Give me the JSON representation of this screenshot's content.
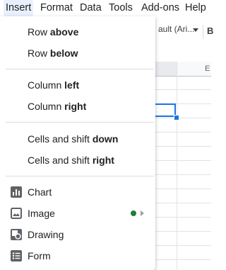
{
  "menubar": {
    "items": [
      "Insert",
      "Format",
      "Data",
      "Tools",
      "Add-ons",
      "Help"
    ]
  },
  "toolbar": {
    "left_glyph": "'",
    "font_name": "ault (Ari...",
    "bold_icon": "B"
  },
  "sheet": {
    "column_letter": "E"
  },
  "insert_menu": {
    "row_above": {
      "prefix": "Row ",
      "bold": "above"
    },
    "row_below": {
      "prefix": "Row ",
      "bold": "below"
    },
    "column_left": {
      "prefix": "Column ",
      "bold": "left"
    },
    "column_right": {
      "prefix": "Column ",
      "bold": "right"
    },
    "cells_down": {
      "prefix": "Cells and shift ",
      "bold": "down"
    },
    "cells_right": {
      "prefix": "Cells and shift ",
      "bold": "right"
    },
    "chart": "Chart",
    "image": "Image",
    "drawing": "Drawing",
    "form": "Form"
  },
  "colors": {
    "accent": "#1a73e8",
    "new_dot": "#188038",
    "menu_active_bg": "#e8f0fe"
  },
  "icons": {
    "chart": "chart-icon",
    "image": "image-icon",
    "drawing": "drawing-icon",
    "form": "form-icon"
  }
}
